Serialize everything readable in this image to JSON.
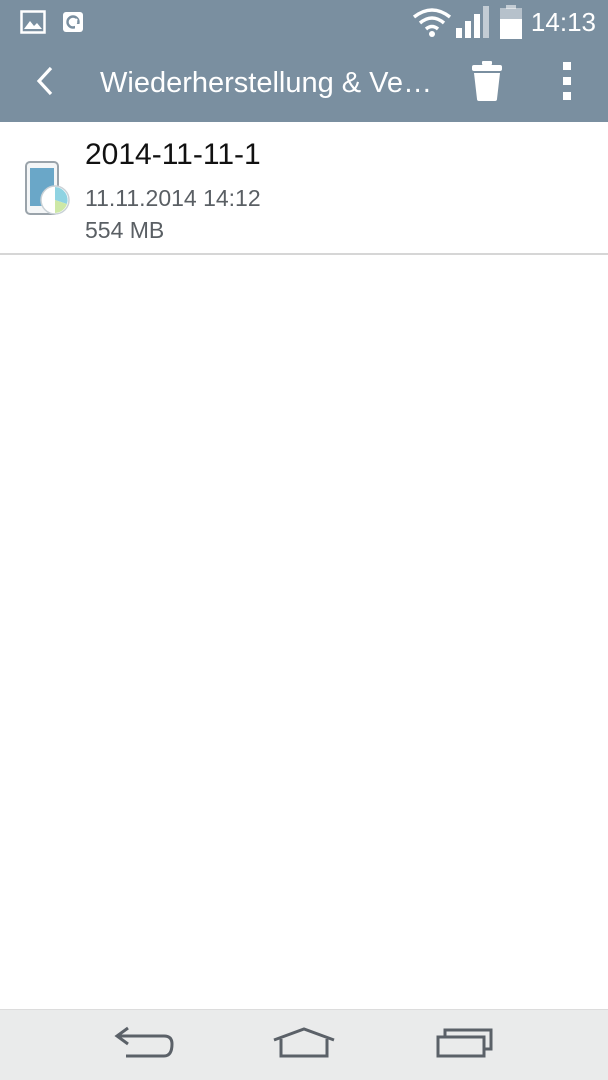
{
  "status_bar": {
    "time": "14:13",
    "icons": [
      "gallery-icon",
      "sync-icon",
      "wifi-icon",
      "signal-icon",
      "battery-icon"
    ]
  },
  "app_bar": {
    "title": "Wiederherstellung & Verwaltung",
    "back_icon": "back-arrow-icon",
    "delete_icon": "trash-icon",
    "menu_icon": "overflow-menu-icon"
  },
  "backups": [
    {
      "name": "2014-11-11-1",
      "date": "11.11.2014 14:12",
      "size": "554 MB",
      "icon": "phone-backup-icon"
    }
  ],
  "nav_bar": {
    "icons": [
      "nav-back-icon",
      "nav-home-icon",
      "nav-recents-icon"
    ]
  },
  "colors": {
    "header": "#7a8fa0",
    "nav_bar": "#eaebeb",
    "divider": "#d6d6d6",
    "secondary_text": "#5a5f64"
  }
}
